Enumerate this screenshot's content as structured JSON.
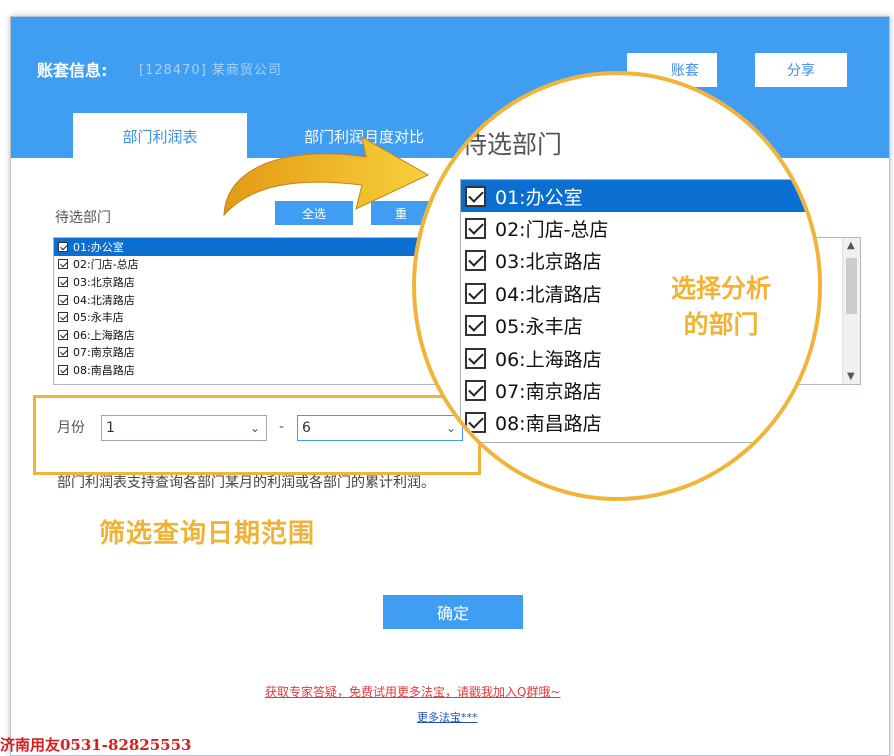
{
  "header": {
    "account_label": "账套信息:",
    "account_value": "[128470] 某商贸公司",
    "account_button": "账套",
    "share_button": "分享"
  },
  "tabs": [
    {
      "label": "部门利润表",
      "active": true
    },
    {
      "label": "部门利润月度对比",
      "active": false
    }
  ],
  "departments": {
    "label": "待选部门",
    "select_all": "全选",
    "reset": "重",
    "items": [
      {
        "label": "01:办公室",
        "checked": true,
        "selected": true
      },
      {
        "label": "02:门店-总店",
        "checked": true,
        "selected": false
      },
      {
        "label": "03:北京路店",
        "checked": true,
        "selected": false
      },
      {
        "label": "04:北清路店",
        "checked": true,
        "selected": false
      },
      {
        "label": "05:永丰店",
        "checked": true,
        "selected": false
      },
      {
        "label": "06:上海路店",
        "checked": true,
        "selected": false
      },
      {
        "label": "07:南京路店",
        "checked": true,
        "selected": false
      },
      {
        "label": "08:南昌路店",
        "checked": true,
        "selected": false
      }
    ]
  },
  "month": {
    "label": "月份",
    "from": "1",
    "separator": "-",
    "to": "6"
  },
  "description": "部门利润表支持查询各部门某月的利润或各部门的累计利润。",
  "annotations": {
    "filter_note": "筛选查询日期范围",
    "dept_note_line1": "选择分析",
    "dept_note_line2": "的部门"
  },
  "confirm_button": "确定",
  "footer": {
    "promo_link": "获取专家答疑，免费试用更多法宝，请戳我加入Q群哦~",
    "more_link": "更多法宝***"
  },
  "contact": "济南用友0531-82825553",
  "colors": {
    "header_blue": "#3f9ef2",
    "highlight_orange": "#f0b43a",
    "selection_blue": "#0a6fd1"
  }
}
